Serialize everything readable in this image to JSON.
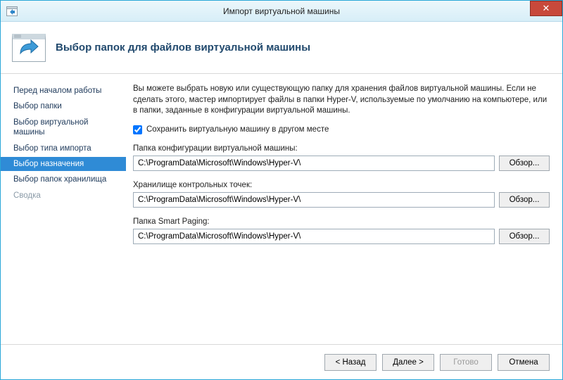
{
  "titlebar": {
    "title": "Импорт виртуальной машины",
    "close_glyph": "✕"
  },
  "header": {
    "title": "Выбор папок для файлов виртуальной машины"
  },
  "sidebar": {
    "items": [
      {
        "label": "Перед началом работы",
        "state": "normal"
      },
      {
        "label": "Выбор папки",
        "state": "normal"
      },
      {
        "label": "Выбор виртуальной машины",
        "state": "normal"
      },
      {
        "label": "Выбор типа импорта",
        "state": "normal"
      },
      {
        "label": "Выбор назначения",
        "state": "selected"
      },
      {
        "label": "Выбор папок хранилища",
        "state": "normal"
      },
      {
        "label": "Сводка",
        "state": "disabled"
      }
    ]
  },
  "main": {
    "intro": "Вы можете выбрать новую или существующую папку для хранения файлов виртуальной машины. Если не сделать этого, мастер импортирует файлы в папки Hyper-V, используемые по умолчанию на компьютере, или в папки, заданные в конфигурации виртуальной машины.",
    "checkbox": {
      "checked": true,
      "label": "Сохранить виртуальную машину в другом месте"
    },
    "fields": [
      {
        "label": "Папка конфигурации виртуальной машины:",
        "value": "C:\\ProgramData\\Microsoft\\Windows\\Hyper-V\\",
        "browse": "Обзор..."
      },
      {
        "label": "Хранилище контрольных точек:",
        "value": "C:\\ProgramData\\Microsoft\\Windows\\Hyper-V\\",
        "browse": "Обзор..."
      },
      {
        "label": "Папка Smart Paging:",
        "value": "C:\\ProgramData\\Microsoft\\Windows\\Hyper-V\\",
        "browse": "Обзор..."
      }
    ]
  },
  "footer": {
    "back": "< Назад",
    "next": "Далее >",
    "finish": "Готово",
    "cancel": "Отмена",
    "finish_enabled": false
  }
}
